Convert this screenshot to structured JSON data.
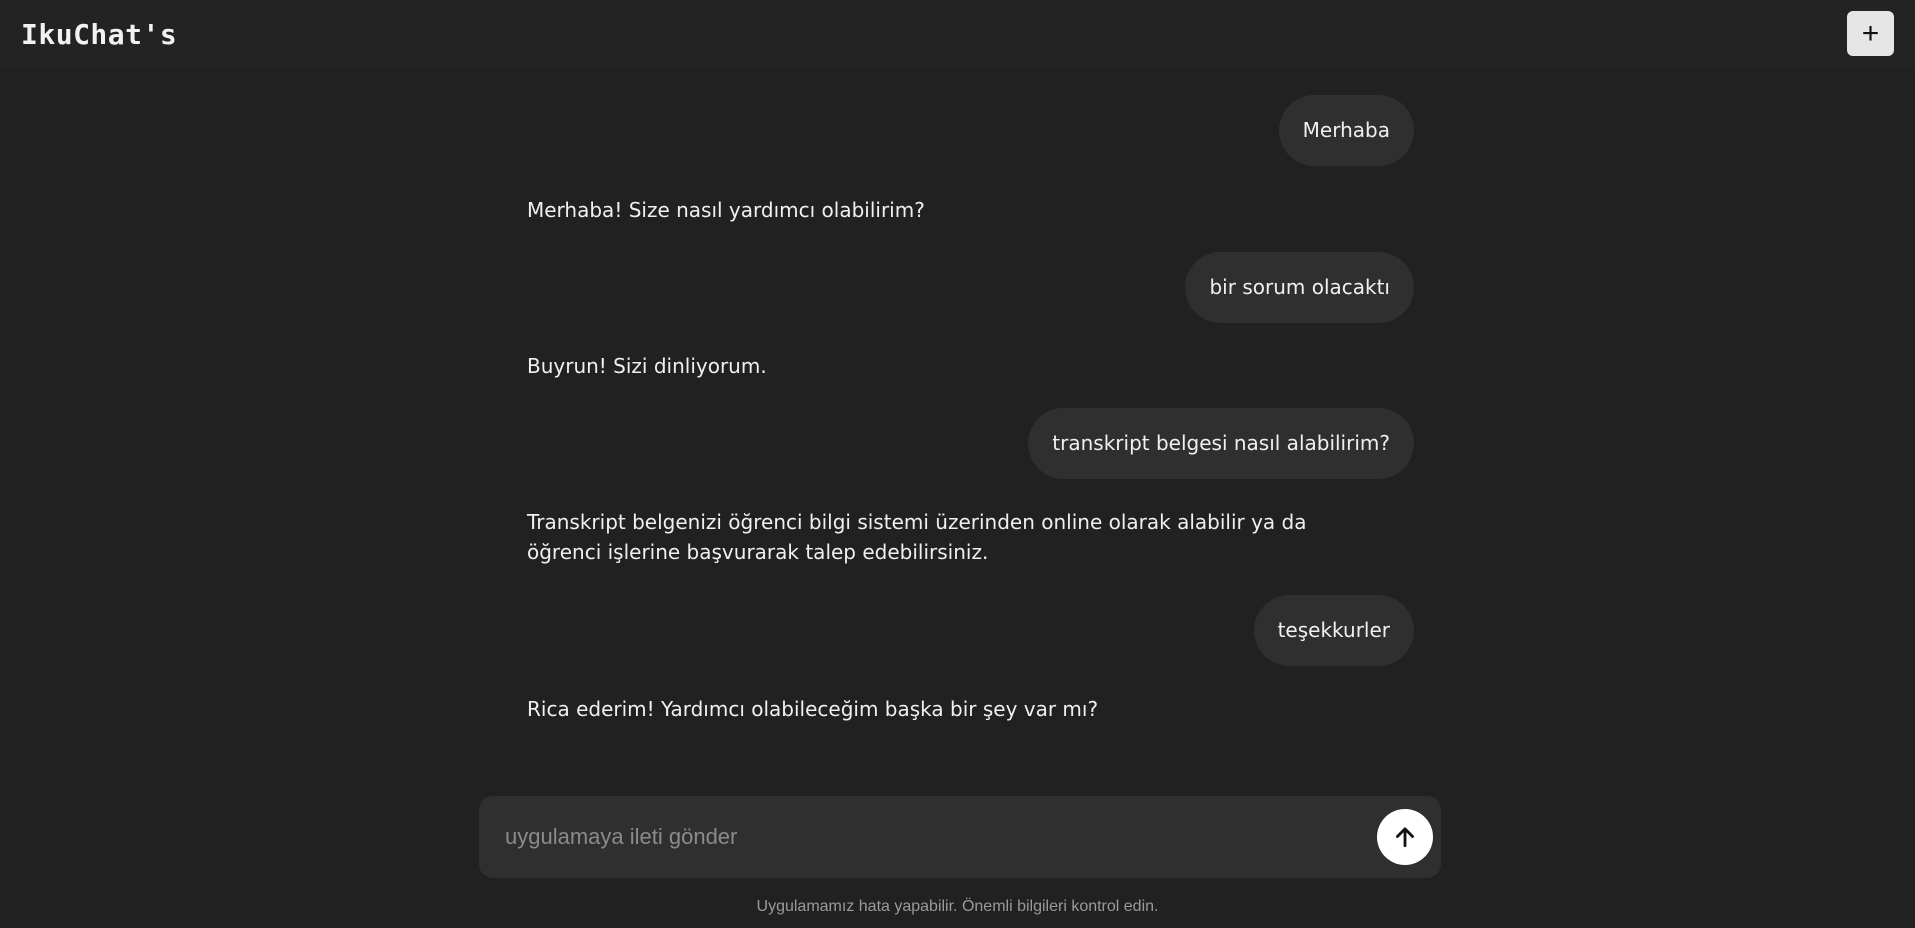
{
  "header": {
    "logo": "IkuChat's",
    "new_chat_label": "+"
  },
  "messages": [
    {
      "role": "user",
      "text": "Merhaba"
    },
    {
      "role": "assistant",
      "text": "Merhaba! Size nasıl yardımcı olabilirim?"
    },
    {
      "role": "user",
      "text": "bir sorum olacaktı"
    },
    {
      "role": "assistant",
      "text": "Buyrun! Sizi dinliyorum."
    },
    {
      "role": "user",
      "text": "transkript belgesi nasıl alabilirim?"
    },
    {
      "role": "assistant",
      "text": "Transkript belgenizi öğrenci bilgi sistemi üzerinden online olarak alabilir ya da öğrenci işlerine başvurarak talep edebilirsiniz."
    },
    {
      "role": "user",
      "text": "teşekkurler"
    },
    {
      "role": "assistant",
      "text": "Rica ederim! Yardımcı olabileceğim başka bir şey var mı?"
    }
  ],
  "composer": {
    "placeholder": "uygulamaya ileti gönder",
    "value": "",
    "send_icon": "arrow-up-icon"
  },
  "footer": {
    "disclaimer": "Uygulamamız hata yapabilir. Önemli bilgileri kontrol edin."
  },
  "colors": {
    "background": "#212121",
    "header": "#232323",
    "bubble": "#2f2f2f",
    "composer": "#2f2f2f",
    "send_button": "#ffffff",
    "new_chat_button": "#e6e6e6"
  }
}
